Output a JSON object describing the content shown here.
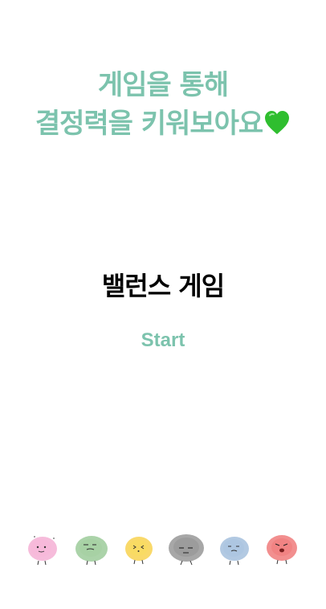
{
  "headline": {
    "line1": "게임을 통해",
    "line2": "결정력을 키워보아요",
    "emoji": "green-heart-icon"
  },
  "game": {
    "title": "밸런스 게임"
  },
  "start_button": {
    "label": "Start"
  },
  "colors": {
    "accent": "#7cc3ad",
    "heart": "#2fbe2f",
    "title": "#000000"
  },
  "characters": [
    {
      "name": "pink-fluff-character-icon",
      "color": "#f3a6cf"
    },
    {
      "name": "green-fluff-character-icon",
      "color": "#8fc48c"
    },
    {
      "name": "yellow-fluff-character-icon",
      "color": "#f7cf45"
    },
    {
      "name": "gray-fluff-character-icon",
      "color": "#8a8a8a"
    },
    {
      "name": "blue-fluff-character-icon",
      "color": "#98b7d8"
    },
    {
      "name": "red-fluff-character-icon",
      "color": "#ee6a6a"
    }
  ]
}
